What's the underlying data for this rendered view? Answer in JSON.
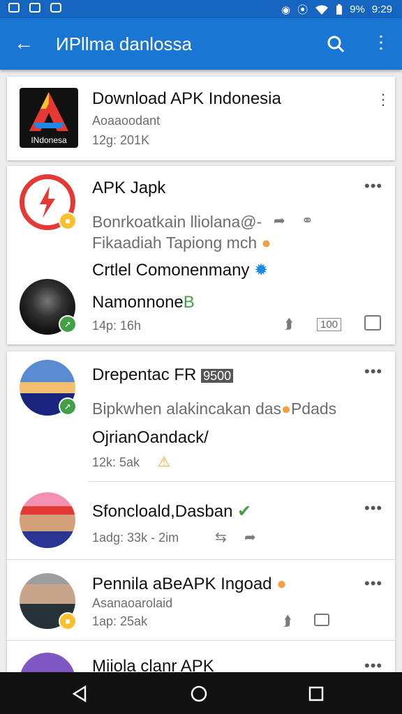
{
  "status": {
    "battery": "9%",
    "time": "9:29"
  },
  "appbar": {
    "title": "ИPllma danlossa",
    "back": "←",
    "more": "⋮"
  },
  "items": [
    {
      "name": "Download APK Indonesia",
      "sub1": "Aoaaoodant",
      "meta": "12g: 201K",
      "logo_text": "INdonesa"
    },
    {
      "name": "APK Japk",
      "sub1": "Bonrkoatkain lliolana@-",
      "sub2": "Fikaadiah Tapiong mch",
      "sub3": "Crtlel Comonenmany",
      "sub4": "Namonnone",
      "sub4_accent": "B",
      "meta": "14p: 16h",
      "count": "100"
    },
    {
      "name": "Drepentac FR",
      "name_tag": "9500",
      "sub1": "Bipkwhen alakincakan das",
      "sub1_tail": "Pdads",
      "sub2": "OjrianOandack/",
      "meta": "12k: 5ak"
    },
    {
      "name": "Sfoncloald,Dasban",
      "meta": "1adg: 33k - 2im"
    },
    {
      "name": "Pennila aBeAPK Ingoad",
      "sub1": "Asanaoarolaid",
      "meta": "1ap: 25ak"
    },
    {
      "name": "Miiola clanr APK"
    }
  ],
  "colors": {
    "appbar": "#1976d2",
    "statusbar": "#1565c0",
    "verified": "#43a047",
    "warning": "#fbc02d"
  }
}
